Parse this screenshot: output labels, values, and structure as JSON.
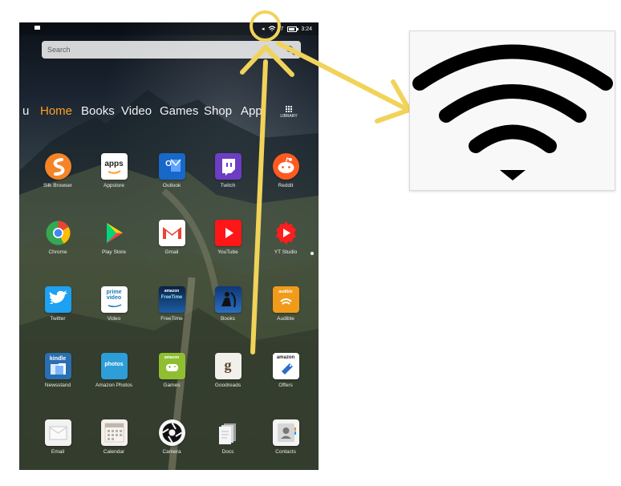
{
  "status": {
    "battery": "3:24",
    "indicator": "7"
  },
  "search": {
    "placeholder": "Search"
  },
  "tabs": [
    {
      "label": "u"
    },
    {
      "label": "Home"
    },
    {
      "label": "Books"
    },
    {
      "label": "Video"
    },
    {
      "label": "Games"
    },
    {
      "label": "Shop"
    },
    {
      "label": "App"
    }
  ],
  "library_label": "LIBRARY",
  "apps": [
    {
      "label": "Silk Browser",
      "icon": "silk-browser-icon",
      "color": "#f58426"
    },
    {
      "label": "Appstore",
      "icon": "appstore-icon",
      "color": "#ffffff"
    },
    {
      "label": "Outlook",
      "icon": "outlook-icon",
      "color": "#1768c8"
    },
    {
      "label": "Twitch",
      "icon": "twitch-icon",
      "color": "#6b3ec3"
    },
    {
      "label": "Reddit",
      "icon": "reddit-icon",
      "color": "#ff5a1f"
    },
    {
      "label": "Chrome",
      "icon": "chrome-icon",
      "color": "#ffffff"
    },
    {
      "label": "Play Store",
      "icon": "play-store-icon",
      "color": "#ffffff"
    },
    {
      "label": "Gmail",
      "icon": "gmail-icon",
      "color": "#ffffff"
    },
    {
      "label": "YouTube",
      "icon": "youtube-icon",
      "color": "#ff1616"
    },
    {
      "label": "YT Studio",
      "icon": "yt-studio-icon",
      "color": "#ff1d1d"
    },
    {
      "label": "Twitter",
      "icon": "twitter-icon",
      "color": "#1da1f2"
    },
    {
      "label": "Video",
      "icon": "prime-video-icon",
      "color": "#ffffff"
    },
    {
      "label": "FreeTime",
      "icon": "freetime-icon",
      "color": "#0d1c3b"
    },
    {
      "label": "Books",
      "icon": "books-icon",
      "color": "#1b4d9b"
    },
    {
      "label": "Audible",
      "icon": "audible-icon",
      "color": "#f19b1b"
    },
    {
      "label": "Newsstand",
      "icon": "newsstand-icon",
      "color": "#2a6fb1"
    },
    {
      "label": "Amazon Photos",
      "icon": "amazon-photos-icon",
      "color": "#2d9ed8"
    },
    {
      "label": "Games",
      "icon": "games-icon",
      "color": "#8fbf31"
    },
    {
      "label": "Goodreads",
      "icon": "goodreads-icon",
      "color": "#f2f0ea"
    },
    {
      "label": "Offers",
      "icon": "offers-icon",
      "color": "#ffffff"
    },
    {
      "label": "Email",
      "icon": "email-icon",
      "color": "#f2f2f2"
    },
    {
      "label": "Calendar",
      "icon": "calendar-icon",
      "color": "#f4f0eb"
    },
    {
      "label": "Camera",
      "icon": "camera-icon",
      "color": "#f7f7f7"
    },
    {
      "label": "Docs",
      "icon": "docs-icon",
      "color": "#f4f4f4"
    },
    {
      "label": "Contacts",
      "icon": "contacts-icon",
      "color": "#f4f4f4"
    }
  ],
  "app_icon_text": {
    "appstore": "apps",
    "outlook": "O",
    "twitch": "▣",
    "reddit": "●",
    "prime_video": "prime video",
    "freetime": "FreeTime",
    "amazon": "amazon",
    "goodreads": "g",
    "kindle": "kindle",
    "photos": "photos"
  },
  "highlight": {
    "accent": "#f1d35a",
    "wifi_color": "#000000",
    "panel_bg": "#f8f8f8"
  }
}
